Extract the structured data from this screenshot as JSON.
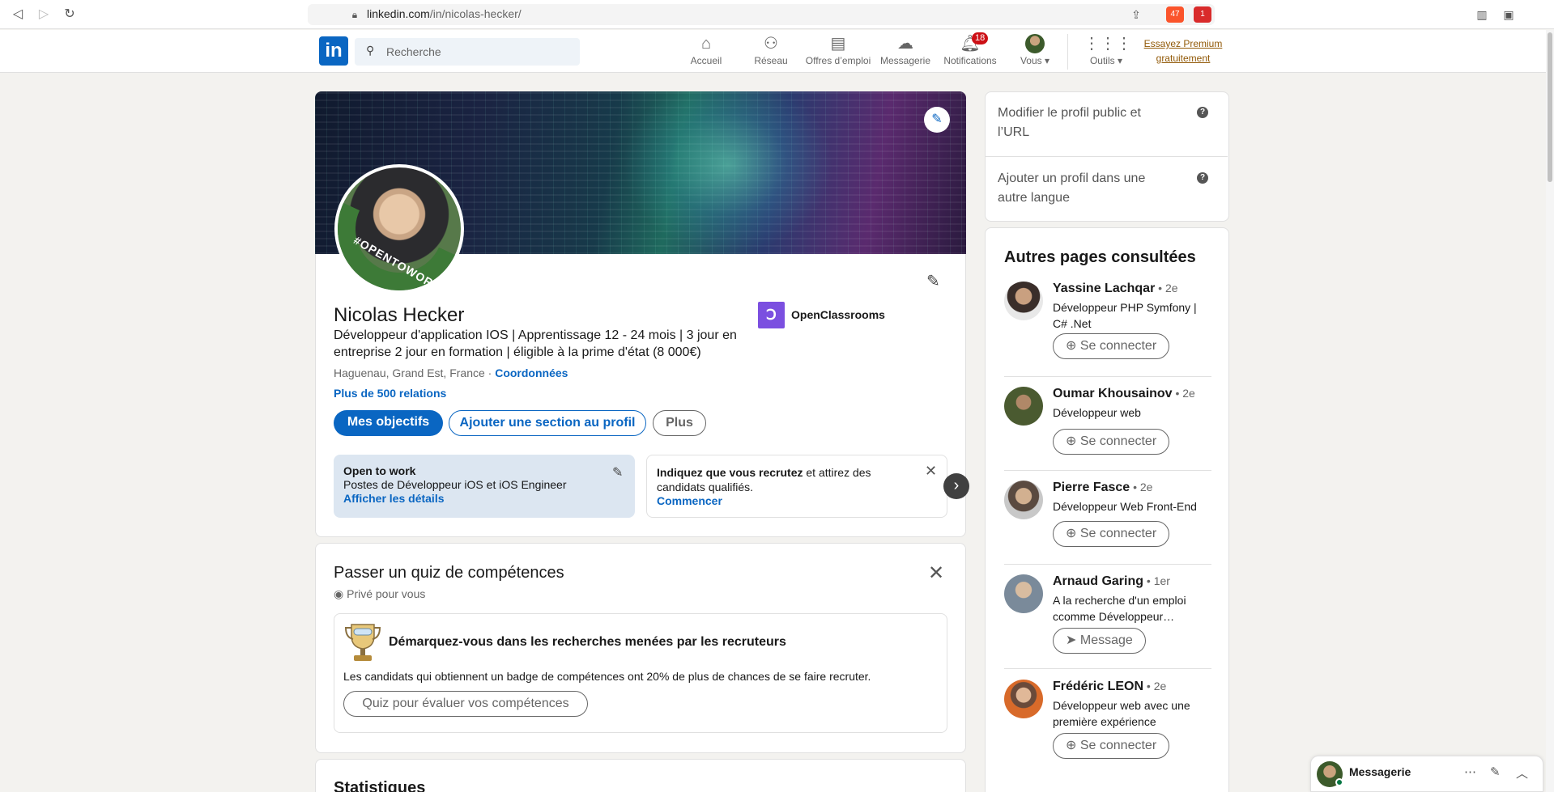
{
  "browser": {
    "url_host": "linkedin.com",
    "url_path": "/in/nicolas-hecker/",
    "ext_badge_1": "47",
    "ext_badge_2": "1"
  },
  "header": {
    "search_placeholder": "Recherche",
    "nav": [
      {
        "label": "Accueil",
        "icon": "home-icon"
      },
      {
        "label": "Réseau",
        "icon": "network-icon"
      },
      {
        "label": "Offres d’emploi",
        "icon": "jobs-icon"
      },
      {
        "label": "Messagerie",
        "icon": "messaging-icon"
      },
      {
        "label": "Notifications",
        "icon": "bell-icon"
      },
      {
        "label": "Vous",
        "icon": "avatar"
      },
      {
        "label": "Outils",
        "icon": "grid-icon"
      }
    ],
    "notifications_count": "18",
    "premium_line1": "Essayez Premium",
    "premium_line2": "gratuitement"
  },
  "profile": {
    "name": "Nicolas Hecker",
    "headline": "Développeur d'application IOS | Apprentissage 12 - 24 mois | 3 jour en entreprise 2 jour en formation | éligible à la prime d'état (8 000€)",
    "location": "Haguenau, Grand Est, France · ",
    "contact_link": "Coordonnées",
    "connections": "Plus de 500 relations",
    "company": "OpenClassrooms",
    "open_to_work_frame": "#OPENTOWORK",
    "buttons": {
      "goals": "Mes objectifs",
      "add_section": "Ajouter une section au profil",
      "more": "Plus"
    },
    "open_to_work": {
      "title": "Open to work",
      "roles": "Postes de Développeur iOS et iOS Engineer",
      "link": "Afficher les détails"
    },
    "recruiting": {
      "bold": "Indiquez que vous recrutez",
      "rest": " et attirez des candidats qualifiés.",
      "link": "Commencer"
    }
  },
  "quiz": {
    "title": "Passer un quiz de compétences",
    "private": "Privé pour vous",
    "subtitle": "Démarquez-vous dans les recherches menées par les recruteurs",
    "description": "Les candidats qui obtiennent un badge de compétences ont 20% de plus de chances de se faire recruter.",
    "button": "Quiz pour évaluer vos compétences"
  },
  "stats_title": "Statistiques",
  "rail": {
    "edit_public_profile": "Modifier le profil public et l’URL",
    "add_language_profile": "Ajouter un profil dans une autre langue",
    "viewed_title": "Autres pages consultées",
    "people": [
      {
        "name": "Yassine Lachqar",
        "degree": " • 2e",
        "desc": "Développeur PHP Symfony | C# .Net",
        "action": "Se connecter"
      },
      {
        "name": "Oumar Khousainov",
        "degree": " • 2e",
        "desc": "Développeur web",
        "action": "Se connecter"
      },
      {
        "name": "Pierre Fasce",
        "degree": " • 2e",
        "desc": "Développeur Web Front-End",
        "action": "Se connecter"
      },
      {
        "name": "Arnaud Garing",
        "degree": " • 1er",
        "desc": "A la recherche d'un emploi ccomme Développeur…",
        "action": "Message"
      },
      {
        "name": "Frédéric LEON",
        "degree": " • 2e",
        "desc": "Développeur web avec une première expérience",
        "action": "Se connecter"
      }
    ]
  },
  "messaging": {
    "label": "Messagerie"
  }
}
